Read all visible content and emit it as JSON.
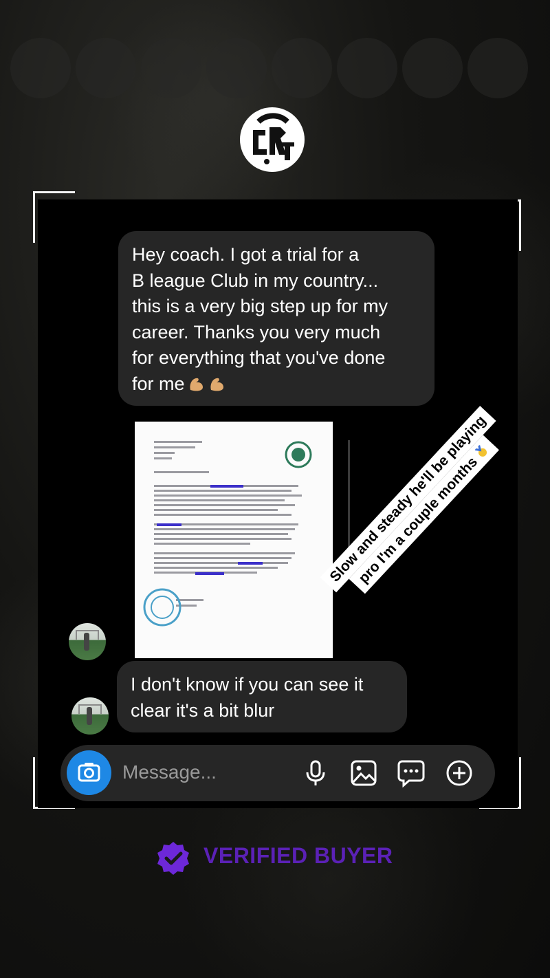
{
  "story": {
    "logo_icon": "brand-monogram-icon",
    "accent_color": "#5b21b6"
  },
  "chat": {
    "messages": [
      {
        "text": "Hey coach. I got a trial for a\nB league Club in my country...\nthis is a very big step up for my\ncareer.  Thanks you very much\nfor everything that you've done\nfor me",
        "emoji": "flexed-biceps-icon"
      },
      {
        "attachment": "document-photo",
        "doc_icon": "club-crest-icon"
      },
      {
        "text": "I don't know if you can see it\nclear it's a bit blur"
      }
    ],
    "composer": {
      "placeholder": "Message...",
      "camera_color": "#1e88e5"
    }
  },
  "sticker": {
    "line1": "Slow and steady he'll be playing",
    "line2": "pro I'm a couple months",
    "emoji": "medal-icon"
  },
  "badge": {
    "label": "VERIFIED BUYER",
    "color": "#5b21b6"
  }
}
